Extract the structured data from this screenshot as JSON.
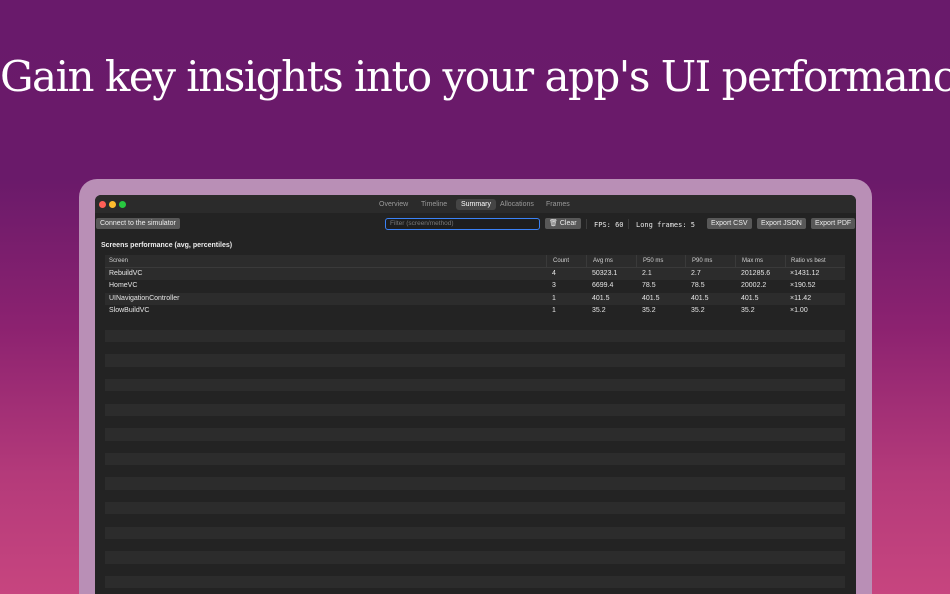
{
  "headline": "Gain key insights into your app's UI performance",
  "window": {
    "tabs": [
      {
        "label": "Overview"
      },
      {
        "label": "Timeline"
      },
      {
        "label": "Summary"
      },
      {
        "label": "Allocations"
      },
      {
        "label": "Frames"
      }
    ],
    "active_tab": "Summary"
  },
  "toolbar": {
    "connect_label": "Connect to the simulator",
    "filter_placeholder": "Filter (screen/method)",
    "clear_label": "Clear",
    "fps_text": "FPS: 60",
    "long_frames_text": "Long frames: 5",
    "export_csv": "Export CSV",
    "export_json": "Export JSON",
    "export_pdf": "Export PDF"
  },
  "section_title": "Screens performance (avg, percentiles)",
  "table": {
    "columns": [
      "Screen",
      "Count",
      "Avg ms",
      "P50 ms",
      "P90 ms",
      "Max ms",
      "Ratio vs best"
    ],
    "rows": [
      [
        "RebuildVC",
        "4",
        "50323.1",
        "2.1",
        "2.7",
        "201285.6",
        "×1431.12"
      ],
      [
        "HomeVC",
        "3",
        "6699.4",
        "78.5",
        "78.5",
        "20002.2",
        "×190.52"
      ],
      [
        "UINavigationController",
        "1",
        "401.5",
        "401.5",
        "401.5",
        "401.5",
        "×11.42"
      ],
      [
        "SlowBuildVC",
        "1",
        "35.2",
        "35.2",
        "35.2",
        "35.2",
        "×1.00"
      ]
    ]
  },
  "colors": {
    "background_top": "#691a6b",
    "background_bottom": "#c7457f",
    "frame": "#b98fb6",
    "window_bg": "#232323",
    "accent_focus": "#3b82f6"
  }
}
